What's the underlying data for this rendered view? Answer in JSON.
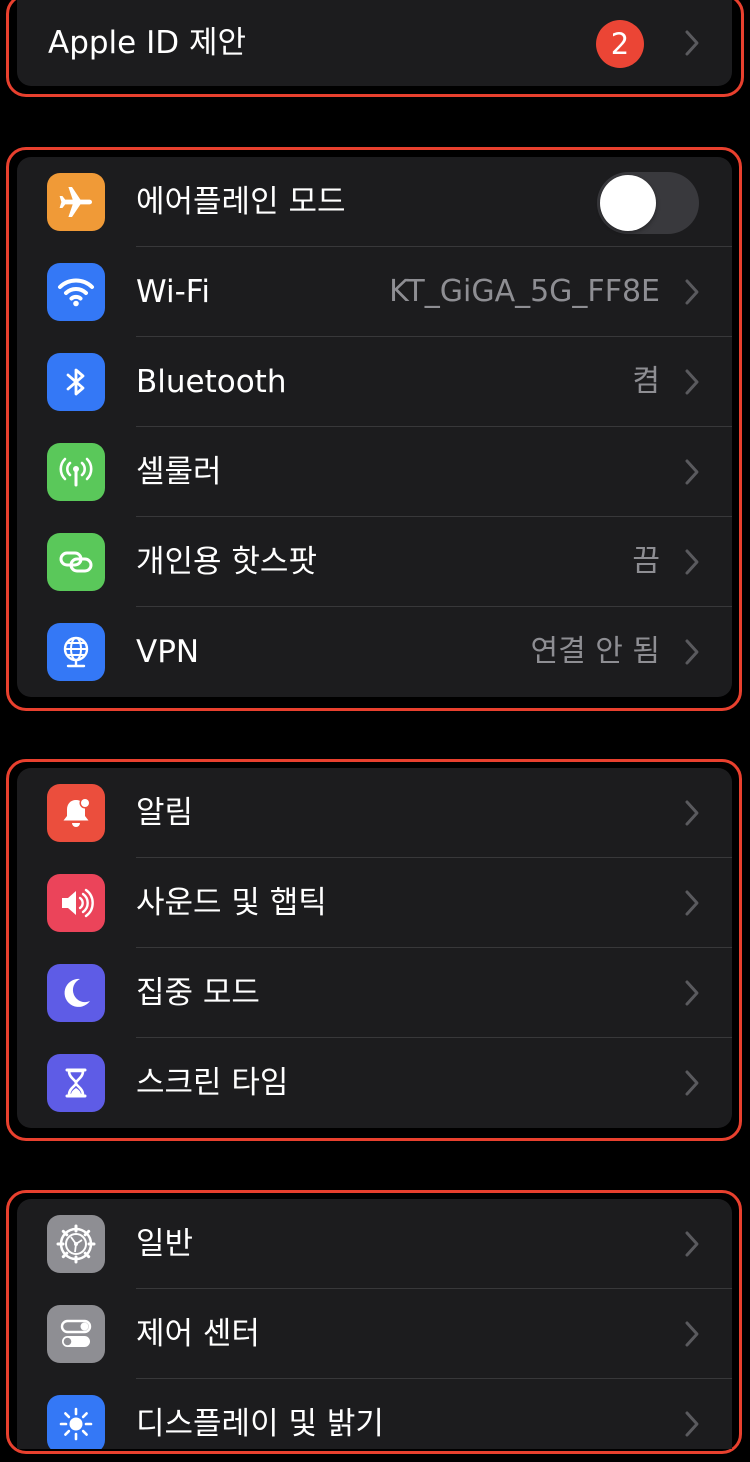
{
  "apple_id": {
    "label": "Apple ID 제안",
    "badge": "2"
  },
  "connectivity": {
    "airplane": {
      "label": "에어플레인 모드",
      "toggle_on": false,
      "icon": "airplane-icon",
      "color": "#f09a37"
    },
    "wifi": {
      "label": "Wi-Fi",
      "value": "KT_GiGA_5G_FF8E",
      "icon": "wifi-icon",
      "color": "#3478f6"
    },
    "bluetooth": {
      "label": "Bluetooth",
      "value": "켬",
      "icon": "bluetooth-icon",
      "color": "#3478f6"
    },
    "cellular": {
      "label": "셀룰러",
      "icon": "antenna-icon",
      "color": "#5ac85a"
    },
    "hotspot": {
      "label": "개인용 핫스팟",
      "value": "끔",
      "icon": "chain-link-icon",
      "color": "#5ac85a"
    },
    "vpn": {
      "label": "VPN",
      "value": "연결 안 됨",
      "icon": "globe-icon",
      "color": "#3478f6"
    }
  },
  "notifications_group": {
    "notifications": {
      "label": "알림",
      "icon": "bell-icon",
      "color": "#eb4e3d"
    },
    "sounds": {
      "label": "사운드 및 햅틱",
      "icon": "speaker-icon",
      "color": "#eb445a"
    },
    "focus": {
      "label": "집중 모드",
      "icon": "moon-icon",
      "color": "#5e5ce6"
    },
    "screen_time": {
      "label": "스크린 타임",
      "icon": "hourglass-icon",
      "color": "#5e5ce6"
    }
  },
  "general_group": {
    "general": {
      "label": "일반",
      "icon": "gear-icon",
      "color": "#8e8e93"
    },
    "control_center": {
      "label": "제어 센터",
      "icon": "switches-icon",
      "color": "#8e8e93"
    },
    "display": {
      "label": "디스플레이 및 밝기",
      "icon": "sun-icon",
      "color": "#3478f6"
    }
  },
  "highlight_color": "#e8402e"
}
